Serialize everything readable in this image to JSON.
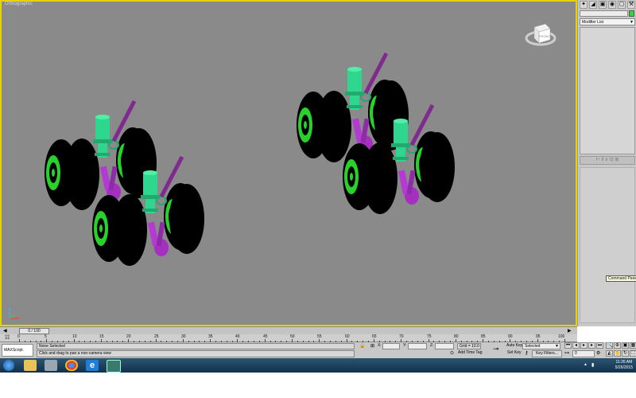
{
  "viewport": {
    "label": "Orthographic",
    "viewcube_label": "FRONT",
    "background_color": "#8a8a8a",
    "active_border_color": "#e6d400"
  },
  "command_panel": {
    "tab_icons": [
      "create-icon",
      "modify-icon",
      "hierarchy-icon",
      "motion-icon",
      "display-icon",
      "utilities-icon"
    ],
    "object_color": "#39d33b",
    "modifier_list": "Modifier List",
    "tooltip": "Command Panel"
  },
  "timeline": {
    "slider_label": "0 / 100",
    "ticks": [
      "0",
      "5",
      "10",
      "15",
      "20",
      "25",
      "30",
      "35",
      "40",
      "45",
      "50",
      "55",
      "60",
      "65",
      "70",
      "75",
      "80",
      "85",
      "90",
      "95",
      "100"
    ]
  },
  "status": {
    "script_listener": "MAXScript.",
    "selection": "None Selected",
    "prompt": "Click and drag to pan a non-camera view",
    "x_label": "X:",
    "y_label": "Y:",
    "z_label": "Z:",
    "grid": "Grid = 10.0",
    "add_time_tag": "Add Time Tag",
    "auto_key": "Auto Key",
    "set_key": "Set Key",
    "key_mode": "Selected",
    "key_filters": "Key Filters...",
    "frame": "0"
  },
  "taskbar": {
    "apps": [
      "start-button",
      "explorer-icon",
      "calculator-icon",
      "chrome-icon",
      "ie-icon",
      "3dsmax-icon"
    ],
    "time": "11:26 AM",
    "date": "5/26/2015"
  }
}
